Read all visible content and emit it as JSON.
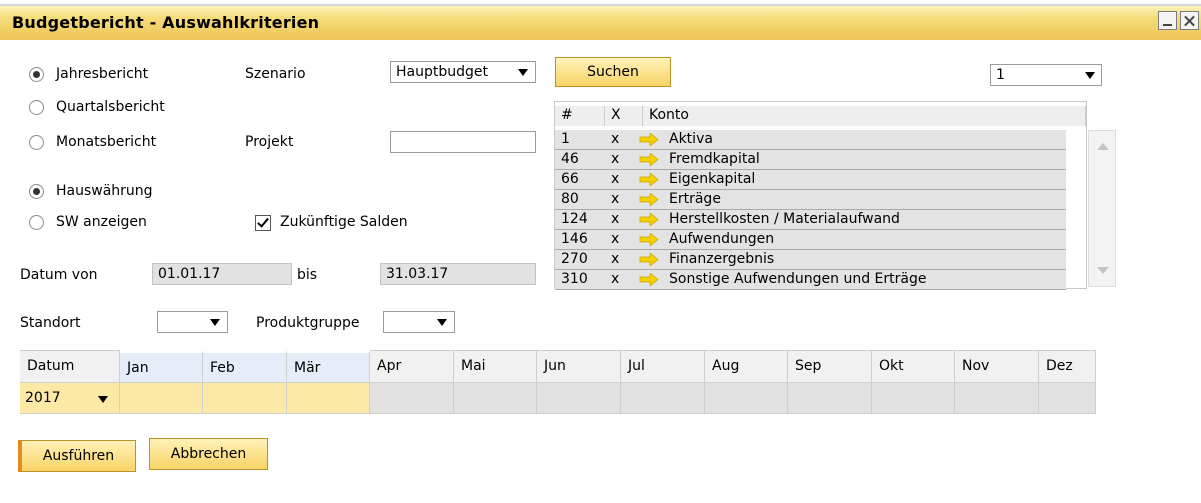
{
  "window": {
    "title": "Budgetbericht - Auswahlkriterien"
  },
  "report_type": [
    {
      "label": "Jahresbericht",
      "selected": true
    },
    {
      "label": "Quartalsbericht",
      "selected": false
    },
    {
      "label": "Monatsbericht",
      "selected": false
    }
  ],
  "currency": [
    {
      "label": "Hauswährung",
      "selected": true
    },
    {
      "label": "SW anzeigen",
      "selected": false
    }
  ],
  "scenario": {
    "label": "Szenario",
    "value": "Hauptbudget"
  },
  "project": {
    "label": "Projekt",
    "value": ""
  },
  "future_balances": {
    "label": "Zukünftige Salden",
    "checked": true
  },
  "date_range": {
    "from_label": "Datum von",
    "from": "01.01.17",
    "to_label": "bis",
    "to": "31.03.17"
  },
  "location": {
    "label": "Standort",
    "value": ""
  },
  "product_group": {
    "label": "Produktgruppe",
    "value": ""
  },
  "search_button": "Suchen",
  "page_select": {
    "value": "1"
  },
  "accounts": {
    "headers": [
      "#",
      "X",
      "Konto"
    ],
    "rows": [
      {
        "num": "1",
        "x": "x",
        "name": "Aktiva"
      },
      {
        "num": "46",
        "x": "x",
        "name": "Fremdkapital"
      },
      {
        "num": "66",
        "x": "x",
        "name": "Eigenkapital"
      },
      {
        "num": "80",
        "x": "x",
        "name": "Erträge"
      },
      {
        "num": "124",
        "x": "x",
        "name": "Herstellkosten / Materialaufwand"
      },
      {
        "num": "146",
        "x": "x",
        "name": "Aufwendungen"
      },
      {
        "num": "270",
        "x": "x",
        "name": "Finanzergebnis"
      },
      {
        "num": "310",
        "x": "x",
        "name": "Sonstige Aufwendungen und Erträge"
      }
    ]
  },
  "periods": {
    "year_header": "Datum",
    "year_value": "2017",
    "months": [
      "Jan",
      "Feb",
      "Mär",
      "Apr",
      "Mai",
      "Jun",
      "Jul",
      "Aug",
      "Sep",
      "Okt",
      "Nov",
      "Dez"
    ],
    "highlighted_months": [
      "Jan",
      "Feb",
      "Mär"
    ]
  },
  "buttons": {
    "run": "Ausführen",
    "cancel": "Abbrechen"
  },
  "colors": {
    "title_bar": "#f6dc7a",
    "button": "#f8d466",
    "selected_period": "#fde9a6",
    "arrow_icon": "#f5d000"
  },
  "icons": [
    "minimize-icon",
    "close-icon",
    "dropdown-arrow-icon",
    "yellow-arrow-icon"
  ]
}
